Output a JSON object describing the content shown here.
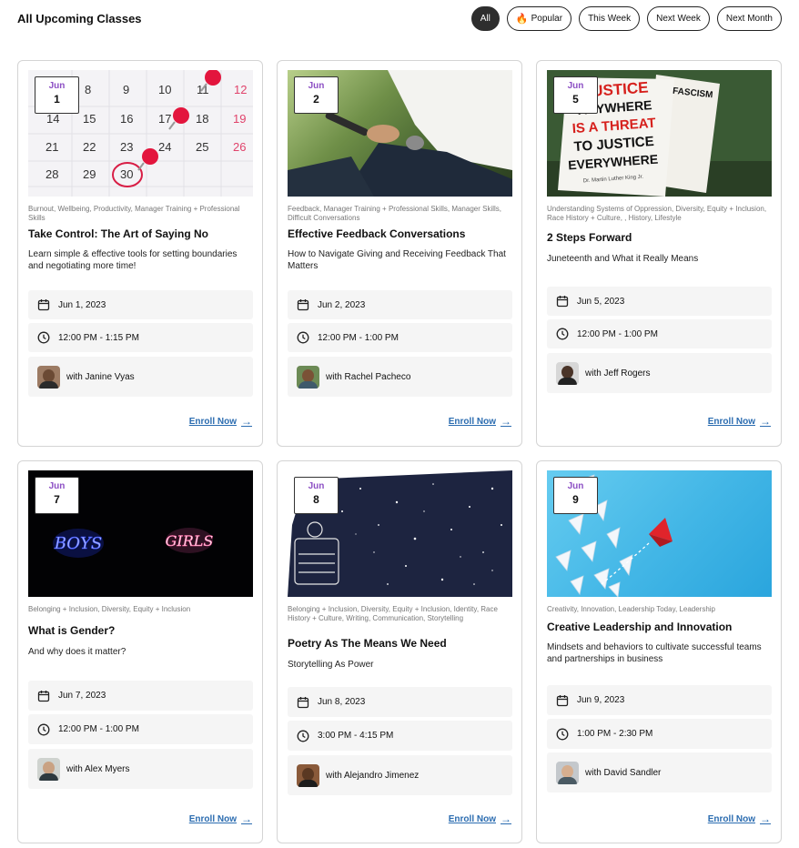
{
  "page": {
    "title": "All Upcoming Classes"
  },
  "filters": [
    {
      "label": "All",
      "active": true
    },
    {
      "label": "Popular",
      "icon": "flame-icon"
    },
    {
      "label": "This Week"
    },
    {
      "label": "Next Week"
    },
    {
      "label": "Next Month"
    }
  ],
  "enroll_label": "Enroll Now",
  "classes": [
    {
      "month": "Jun",
      "day": "1",
      "tags": "Burnout, Wellbeing, Productivity, Manager Training + Professional Skills",
      "title": "Take Control: The Art of Saying No",
      "subtitle": "Learn simple & effective tools for setting boundaries and negotiating more time!",
      "date": "Jun 1, 2023",
      "time": "12:00 PM - 1:15 PM",
      "instructor": "with Janine Vyas"
    },
    {
      "month": "Jun",
      "day": "2",
      "tags": "Feedback, Manager Training + Professional Skills, Manager Skills, Difficult Conversations",
      "title": "Effective Feedback Conversations",
      "subtitle": "How to Navigate Giving and Receiving Feedback That Matters",
      "date": "Jun 2, 2023",
      "time": "12:00 PM - 1:00 PM",
      "instructor": "with Rachel Pacheco"
    },
    {
      "month": "Jun",
      "day": "5",
      "tags": "Understanding Systems of Oppression, Diversity, Equity + Inclusion, Race History + Culture, , History, Lifestyle",
      "title": "2 Steps Forward",
      "subtitle": "Juneteenth and What it Really Means",
      "date": "Jun 5, 2023",
      "time": "12:00 PM - 1:00 PM",
      "instructor": "with Jeff Rogers"
    },
    {
      "month": "Jun",
      "day": "7",
      "tags": "Belonging + Inclusion, Diversity, Equity + Inclusion",
      "title": "What is Gender?",
      "subtitle": "And why does it matter?",
      "date": "Jun 7, 2023",
      "time": "12:00 PM - 1:00 PM",
      "instructor": "with Alex Myers"
    },
    {
      "month": "Jun",
      "day": "8",
      "tags": "Belonging + Inclusion, Diversity, Equity + Inclusion, Identity, Race History + Culture, Writing, Communication, Storytelling",
      "title": "Poetry As The Means We Need",
      "subtitle": "Storytelling As Power",
      "date": "Jun 8, 2023",
      "time": "3:00 PM - 4:15 PM",
      "instructor": "with Alejandro Jimenez"
    },
    {
      "month": "Jun",
      "day": "9",
      "tags": "Creativity, Innovation, Leadership Today, Leadership",
      "title": "Creative Leadership and Innovation",
      "subtitle": "Mindsets and behaviors to cultivate successful teams and partnerships in business",
      "date": "Jun 9, 2023",
      "time": "1:00 PM - 2:30 PM",
      "instructor": "with David Sandler"
    }
  ],
  "image_texts": {
    "calendar_top": [
      "8",
      "9",
      "10",
      "11",
      "12"
    ],
    "calendar_row2": [
      "14",
      "15",
      "16",
      "17",
      "18",
      "19"
    ],
    "calendar_row3": [
      "21",
      "22",
      "23",
      "24",
      "25",
      "26"
    ],
    "calendar_row4": [
      "28",
      "29",
      "30"
    ],
    "protest_sign": [
      "JUSTICE",
      "ANYWHERE",
      "IS A THREAT",
      "TO JUSTICE",
      "EVERYWHERE",
      "Dr. Martin Luther King Jr.",
      "FASCISM"
    ],
    "neon_left": "BOYS",
    "neon_right": "GIRLS"
  },
  "colors": {
    "accent": "#8c4fc4",
    "link": "#2b6cb0",
    "chip_active": "#2e2e2e",
    "info_bg": "#f5f5f5"
  }
}
